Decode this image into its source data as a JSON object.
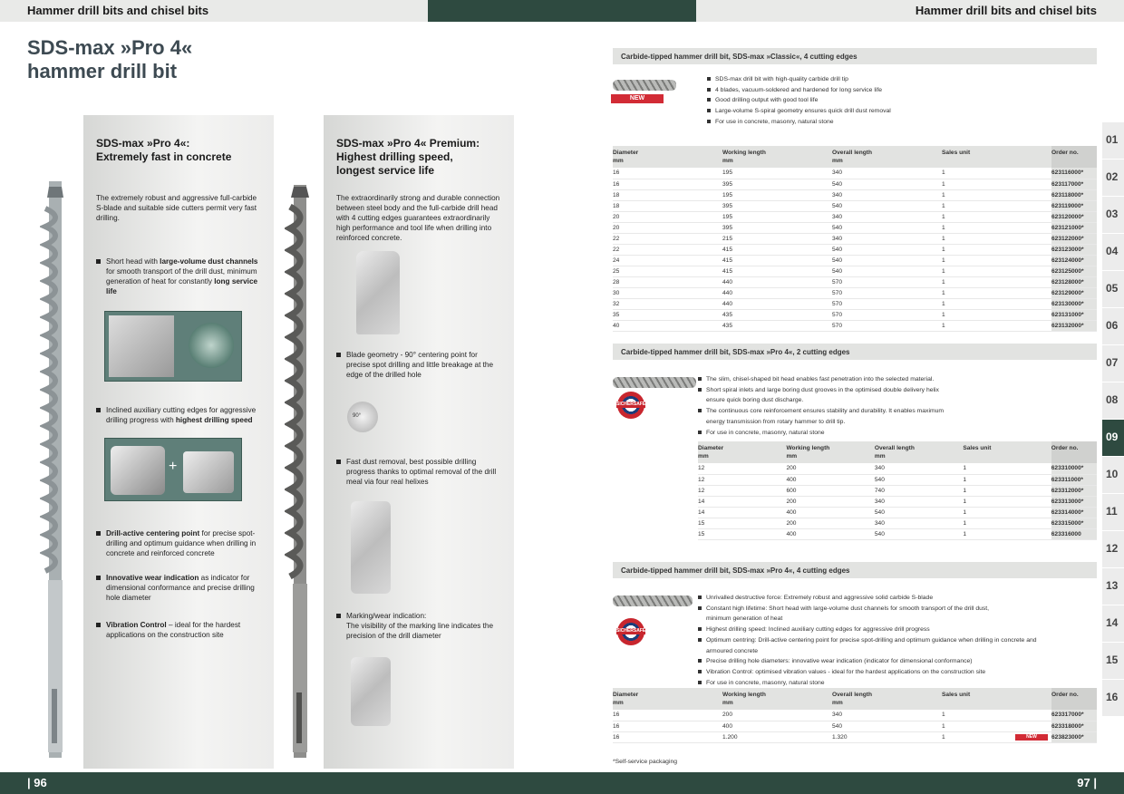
{
  "header": {
    "left_title": "Hammer drill bits and chisel bits",
    "right_title": "Hammer drill bits and chisel bits"
  },
  "footer": {
    "left_page": "| 96",
    "right_page": "97 |"
  },
  "page_title": {
    "line1": "SDS-max »Pro 4«",
    "line2": "hammer drill bit"
  },
  "panel_left": {
    "title_line1": "SDS-max »Pro 4«:",
    "title_line2": "Extremely fast in concrete",
    "intro": "The extremely robust and aggressive full-carbide S-blade and suitable side cutters permit very fast drilling.",
    "b1_pre": "Short head with ",
    "b1_bold": "large-volume dust channels",
    "b1_mid": " for smooth transport of the drill dust, minimum generation of heat for constantly ",
    "b1_bold2": "long service life",
    "b2_pre": "Inclined auxiliary cutting edges for aggressive drilling progress with ",
    "b2_bold": "highest drilling speed",
    "b3_bold": "Drill-active centering point",
    "b3_rest": " for precise spot-drilling and optimum guidance when drilling in concrete and reinforced concrete",
    "b4_bold": "Innovative wear indication",
    "b4_rest": " as indicator for dimensional conformance and precise drilling hole diameter",
    "b5_bold": "Vibration Control",
    "b5_rest": " – ideal for the hardest applications on the construction site"
  },
  "panel_right": {
    "title_line1": "SDS-max »Pro 4« Premium:",
    "title_line2": "Highest drilling speed,",
    "title_line3": "longest service life",
    "intro": "The extraordinarily strong and durable connection between steel body and the full-carbide drill head with 4 cutting edges guarantees extraordinarily high performance and tool life when drilling into reinforced concrete.",
    "b1": "Blade geometry - 90° centering point for precise spot drilling and little breakage at the edge of the drilled hole",
    "angle_label": "90°",
    "b2": "Fast dust removal, best possible drilling progress thanks to optimal removal of the drill meal via four real helixes",
    "b3_line1": "Marking/wear indication:",
    "b3_rest": "The visibility of the marking line indicates the precision of the drill diameter"
  },
  "section1": {
    "title": "Carbide-tipped hammer drill bit, SDS-max »Classic«, 4 cutting edges",
    "badge": "NEW",
    "features": [
      "SDS-max drill bit with high-quality carbide drill tip",
      "4 blades, vacuum-soldered and hardened for long service life",
      "Good drilling output with good tool life",
      "Large-volume S-spiral geometry ensures quick drill dust removal",
      "For use in concrete, masonry, natural stone"
    ],
    "headers": [
      {
        "l1": "Diameter",
        "l2": "mm"
      },
      {
        "l1": "Working length",
        "l2": "mm"
      },
      {
        "l1": "Overall length",
        "l2": "mm"
      },
      {
        "l1": "Sales unit",
        "l2": ""
      },
      {
        "l1": "Order no.",
        "l2": ""
      }
    ],
    "rows": [
      [
        "16",
        "195",
        "340",
        "1",
        "623116000*"
      ],
      [
        "16",
        "395",
        "540",
        "1",
        "623117000*"
      ],
      [
        "18",
        "195",
        "340",
        "1",
        "623118000*"
      ],
      [
        "18",
        "395",
        "540",
        "1",
        "623119000*"
      ],
      [
        "20",
        "195",
        "340",
        "1",
        "623120000*"
      ],
      [
        "20",
        "395",
        "540",
        "1",
        "623121000*"
      ],
      [
        "22",
        "215",
        "340",
        "1",
        "623122000*"
      ],
      [
        "22",
        "415",
        "540",
        "1",
        "623123000*"
      ],
      [
        "24",
        "415",
        "540",
        "1",
        "623124000*"
      ],
      [
        "25",
        "415",
        "540",
        "1",
        "623125000*"
      ],
      [
        "28",
        "440",
        "570",
        "1",
        "623128000*"
      ],
      [
        "30",
        "440",
        "570",
        "1",
        "623129000*"
      ],
      [
        "32",
        "440",
        "570",
        "1",
        "623130000*"
      ],
      [
        "35",
        "435",
        "570",
        "1",
        "623131000*"
      ],
      [
        "40",
        "435",
        "570",
        "1",
        "623132000*"
      ]
    ]
  },
  "section2": {
    "title": "Carbide-tipped hammer drill bit, SDS-max »Pro 4«, 2 cutting edges",
    "safe_label": "SICHERSAFE",
    "features": [
      "The slim, chisel-shaped bit head enables fast penetration into the selected material.",
      "Short spiral inlets and large boring dust grooves in the optimised double delivery helix",
      "ensure quick boring dust discharge.",
      "The continuous core reinforcement ensures stability and durability. It enables maximum",
      "energy transmission from rotary hammer to drill tip.",
      "For use in concrete, masonry, natural stone"
    ],
    "headers": [
      {
        "l1": "Diameter",
        "l2": "mm"
      },
      {
        "l1": "Working length",
        "l2": "mm"
      },
      {
        "l1": "Overall length",
        "l2": "mm"
      },
      {
        "l1": "Sales unit",
        "l2": ""
      },
      {
        "l1": "Order no.",
        "l2": ""
      }
    ],
    "rows": [
      [
        "12",
        "200",
        "340",
        "1",
        "623310000*"
      ],
      [
        "12",
        "400",
        "540",
        "1",
        "623311000*"
      ],
      [
        "12",
        "600",
        "740",
        "1",
        "623312000*"
      ],
      [
        "14",
        "200",
        "340",
        "1",
        "623313000*"
      ],
      [
        "14",
        "400",
        "540",
        "1",
        "623314000*"
      ],
      [
        "15",
        "200",
        "340",
        "1",
        "623315000*"
      ],
      [
        "15",
        "400",
        "540",
        "1",
        "623316000"
      ]
    ]
  },
  "section3": {
    "title": "Carbide-tipped hammer drill bit, SDS-max »Pro 4«, 4 cutting edges",
    "safe_label": "SICHERSAFE",
    "features": [
      "Unrivalled destructive force: Extremely robust and aggressive solid carbide S-blade",
      "Constant high lifetime: Short head with large-volume dust channels for smooth transport of the drill dust,",
      "minimum generation of heat",
      "Highest drilling speed: Inclined auxiliary cutting edges for aggressive drill progress",
      "Optimum centring: Drill-active centering point for precise spot-drilling and optimum guidance when drilling in concrete and",
      "armoured concrete",
      "Precise drilling hole diameters: innovative wear indication (indicator for dimensional conformance)",
      "Vibration Control: optimised vibration values - ideal for the hardest applications on the construction site",
      "For use in concrete, masonry, natural stone"
    ],
    "headers": [
      {
        "l1": "Diameter",
        "l2": "mm"
      },
      {
        "l1": "Working length",
        "l2": "mm"
      },
      {
        "l1": "Overall length",
        "l2": "mm"
      },
      {
        "l1": "Sales unit",
        "l2": ""
      },
      {
        "l1": "Order no.",
        "l2": ""
      }
    ],
    "rows": [
      [
        "16",
        "200",
        "340",
        "1",
        "623317000*"
      ],
      [
        "16",
        "400",
        "540",
        "1",
        "623318000*"
      ],
      [
        "16",
        "1.200",
        "1.320",
        "1",
        "623823000*"
      ]
    ],
    "row_badge": "NEW"
  },
  "footnote": "*Self-service packaging",
  "tabs": [
    "01",
    "02",
    "03",
    "04",
    "05",
    "06",
    "07",
    "08",
    "09",
    "10",
    "11",
    "12",
    "13",
    "14",
    "15",
    "16"
  ],
  "active_tab": "09"
}
